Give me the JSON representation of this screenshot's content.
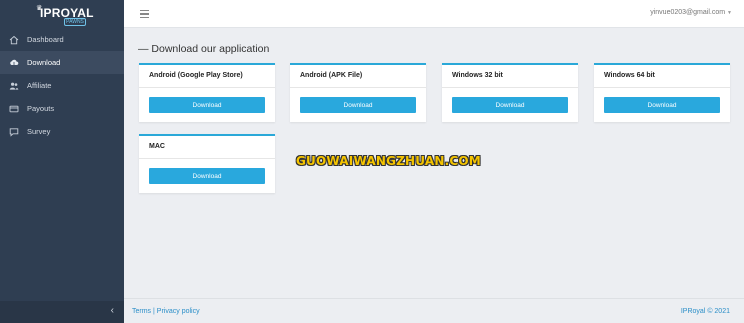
{
  "brand": {
    "name": "IPROYAL",
    "sub": "PAWNS"
  },
  "sidebar": {
    "items": [
      {
        "label": "Dashboard",
        "icon": "home-icon"
      },
      {
        "label": "Download",
        "icon": "cloud-download-icon",
        "active": true
      },
      {
        "label": "Affiliate",
        "icon": "users-icon"
      },
      {
        "label": "Payouts",
        "icon": "payouts-icon"
      },
      {
        "label": "Survey",
        "icon": "survey-icon"
      }
    ],
    "collapse_icon": "chevron-left-icon"
  },
  "topbar": {
    "email": "yinvue0203@gmail.com"
  },
  "main": {
    "title": "— Download our application",
    "cards": [
      {
        "title": "Android (Google Play Store)",
        "button": "Download"
      },
      {
        "title": "Android (APK File)",
        "button": "Download"
      },
      {
        "title": "Windows 32 bit",
        "button": "Download"
      },
      {
        "title": "Windows 64 bit",
        "button": "Download"
      },
      {
        "title": "MAC",
        "button": "Download"
      }
    ]
  },
  "watermark": "GUOWAIWANGZHUAN.COM",
  "footer": {
    "terms": "Terms",
    "separator": "|",
    "privacy": "Privacy policy",
    "copyright": "IPRoyal © 2021"
  },
  "colors": {
    "sidebar_bg": "#2f3e52",
    "accent": "#29a8dd",
    "page_bg": "#eceef2"
  }
}
